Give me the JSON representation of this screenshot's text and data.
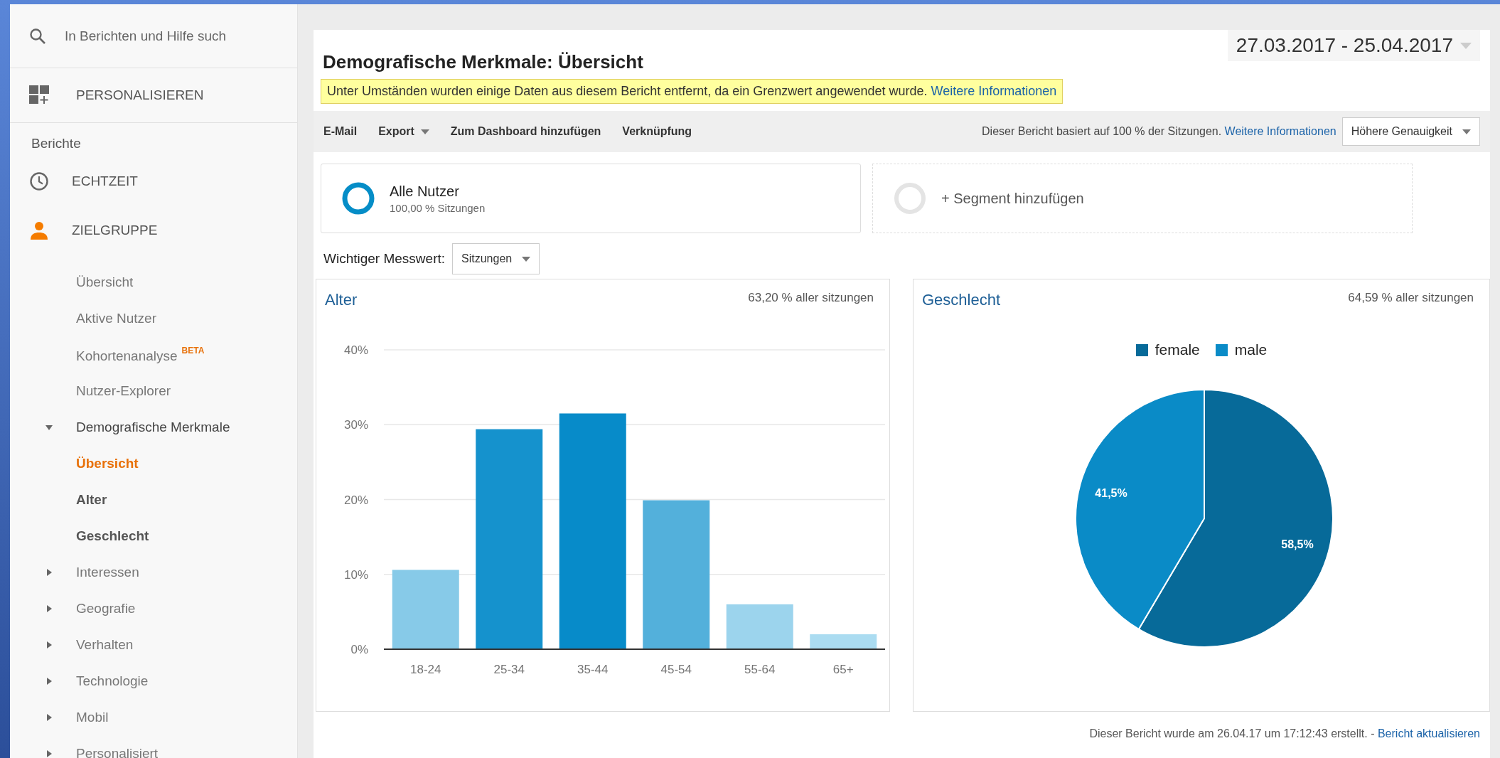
{
  "search": {
    "placeholder": "In Berichten und Hilfe such"
  },
  "customize": {
    "label": "PERSONALISIEREN"
  },
  "sidebar": {
    "section_label": "Berichte",
    "items": [
      {
        "label": "ECHTZEIT",
        "kind": "clock",
        "selected": false
      },
      {
        "label": "ZIELGRUPPE",
        "kind": "person",
        "selected": true,
        "children": [
          {
            "label": "Übersicht",
            "selected": false
          },
          {
            "label": "Aktive Nutzer",
            "selected": false
          },
          {
            "label": "Kohortenanalyse",
            "badge": "BETA",
            "selected": false
          },
          {
            "label": "Nutzer-Explorer",
            "selected": false
          },
          {
            "label": "Demografische Merkmale",
            "selected": false,
            "expanded": true,
            "children": [
              {
                "label": "Übersicht",
                "selected": true
              },
              {
                "label": "Alter",
                "selected": false
              },
              {
                "label": "Geschlecht",
                "selected": false
              }
            ]
          },
          {
            "label": "Interessen",
            "selected": false,
            "expanded": false
          },
          {
            "label": "Geografie",
            "selected": false,
            "expanded": false
          },
          {
            "label": "Verhalten",
            "selected": false,
            "expanded": false
          },
          {
            "label": "Technologie",
            "selected": false,
            "expanded": false
          },
          {
            "label": "Mobil",
            "selected": false,
            "expanded": false
          },
          {
            "label": "Personalisiert",
            "selected": false,
            "expanded": false
          }
        ]
      }
    ]
  },
  "report": {
    "title": "Demografische Merkmale: Übersicht",
    "date_range": "27.03.2017 - 25.04.2017",
    "notice": {
      "text": "Unter Umständen wurden einige Daten aus diesem Bericht entfernt, da ein Grenzwert angewendet wurde.",
      "link": "Weitere Informationen"
    }
  },
  "toolbar": {
    "actions": [
      {
        "label": "E-Mail",
        "dropdown": false
      },
      {
        "label": "Export",
        "dropdown": true
      },
      {
        "label": "Zum Dashboard hinzufügen",
        "dropdown": false
      },
      {
        "label": "Verknüpfung",
        "dropdown": false
      }
    ],
    "sampling_note": "Dieser Bericht basiert auf 100 % der Sitzungen.",
    "sampling_link": "Weitere Informationen",
    "precision": "Höhere Genauigkeit"
  },
  "segments": [
    {
      "kind": "segment",
      "name": "Alle Nutzer",
      "detail": "100,00 % Sitzungen"
    },
    {
      "kind": "add",
      "name": "+ Segment hinzufügen"
    }
  ],
  "metric": {
    "label": "Wichtiger Messwert:",
    "value": "Sitzungen"
  },
  "panels": [
    {
      "title": "Alter",
      "share": "63,20 % aller sitzungen",
      "chart_data": {
        "type": "bar",
        "categories": [
          "18-24",
          "25-34",
          "35-44",
          "45-54",
          "55-64",
          "65+"
        ],
        "series": [
          {
            "values": [
              10.6,
              29.4,
              31.5,
              19.9,
              6.0,
              2.0
            ]
          }
        ],
        "ylim": [
          0,
          40
        ],
        "grid": true,
        "yticks": [
          {
            "value": 0,
            "label": "0%"
          },
          {
            "value": 10,
            "label": "10%"
          },
          {
            "value": 20,
            "label": "20%"
          },
          {
            "value": 30,
            "label": "30%"
          },
          {
            "value": 40,
            "label": "40%"
          }
        ]
      }
    },
    {
      "title": "Geschlecht",
      "share": "64,59 % aller sitzungen",
      "chart_data": {
        "type": "pie",
        "categories": [
          "female",
          "male"
        ],
        "series": [
          {
            "values": [
              58.5,
              41.5
            ]
          }
        ],
        "colors": [
          "#076a99",
          "#0a8bc7"
        ],
        "value_labels": [
          "58,5%",
          "41,5%"
        ]
      }
    }
  ],
  "footer": {
    "text": "Dieser Bericht wurde am 26.04.17 um 17:12:43 erstellt. -",
    "link": "Bericht aktualisieren"
  }
}
